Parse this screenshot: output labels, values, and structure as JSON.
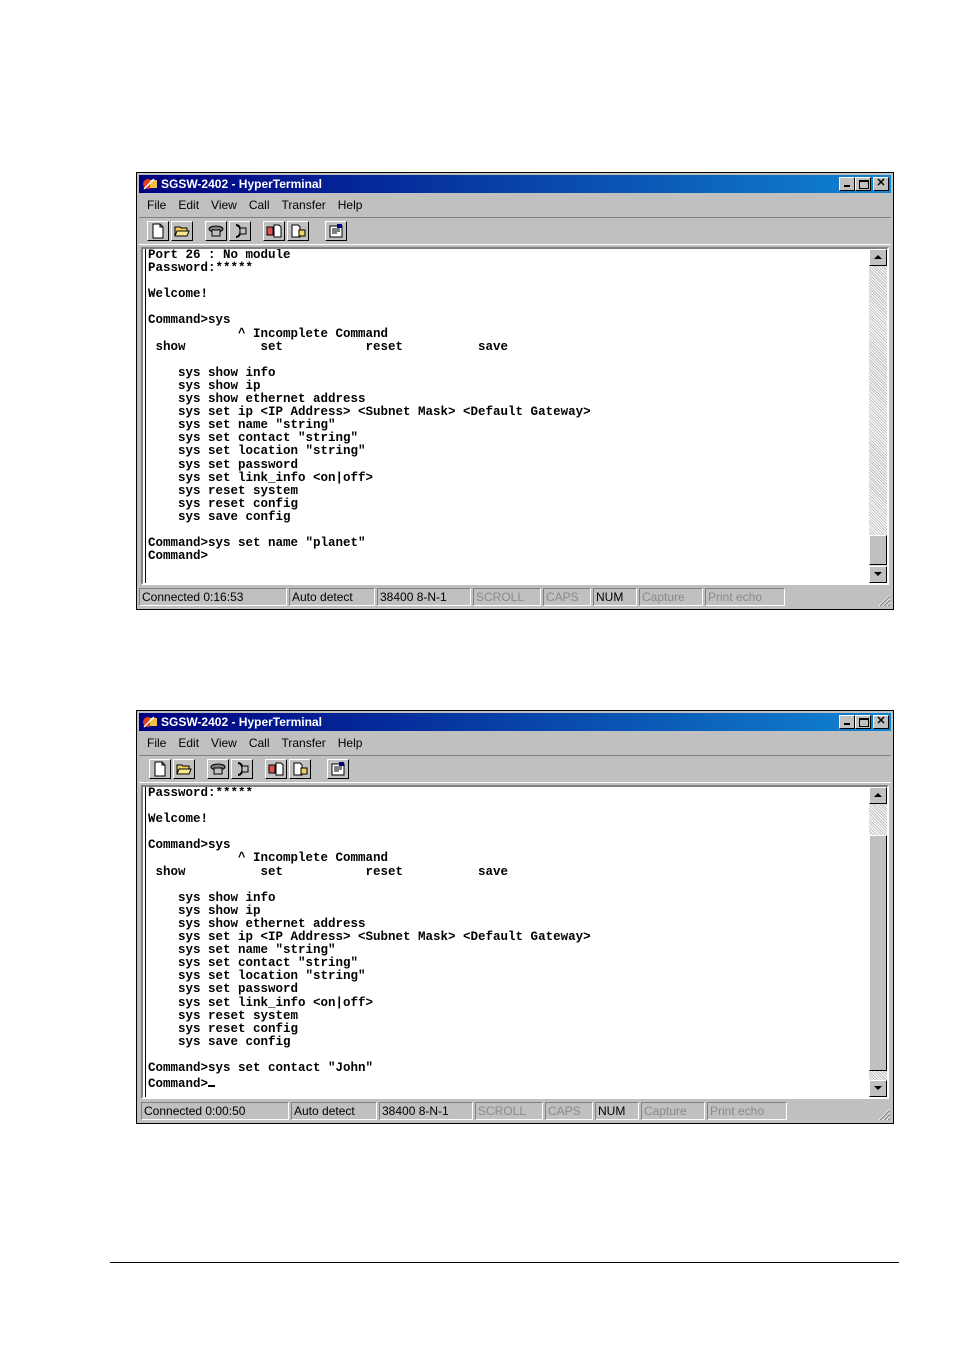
{
  "windows": [
    {
      "title": "SGSW-2402 - HyperTerminal",
      "menu": [
        "File",
        "Edit",
        "View",
        "Call",
        "Transfer",
        "Help"
      ],
      "terminal_lines": [
        "Port 26 : No module",
        "Password:*****",
        "",
        "Welcome!",
        "",
        "Command>sys",
        "            ^ Incomplete Command",
        " show          set           reset          save",
        "",
        "    sys show info",
        "    sys show ip",
        "    sys show ethernet address",
        "    sys set ip <IP Address> <Subnet Mask> <Default Gateway>",
        "    sys set name \"string\"",
        "    sys set contact \"string\"",
        "    sys set location \"string\"",
        "    sys set password",
        "    sys set link_info <on|off>",
        "    sys reset system",
        "    sys reset config",
        "    sys save config",
        "",
        "Command>sys set name \"planet\"",
        "Command>"
      ],
      "status": [
        "Connected 0:16:53",
        "Auto detect",
        "38400 8-N-1",
        "SCROLL",
        "CAPS",
        "NUM",
        "Capture",
        "Print echo"
      ]
    },
    {
      "title": "SGSW-2402 - HyperTerminal",
      "menu": [
        "File",
        "Edit",
        "View",
        "Call",
        "Transfer",
        "Help"
      ],
      "terminal_lines": [
        "Password:*****",
        "",
        "Welcome!",
        "",
        "Command>sys",
        "            ^ Incomplete Command",
        " show          set           reset          save",
        "",
        "    sys show info",
        "    sys show ip",
        "    sys show ethernet address",
        "    sys set ip <IP Address> <Subnet Mask> <Default Gateway>",
        "    sys set name \"string\"",
        "    sys set contact \"string\"",
        "    sys set location \"string\"",
        "    sys set password",
        "    sys set link_info <on|off>",
        "    sys reset system",
        "    sys reset config",
        "    sys save config",
        "",
        "Command>sys set contact \"John\"",
        "Command>"
      ],
      "status": [
        "Connected 0:00:50",
        "Auto detect",
        "38400 8-N-1",
        "SCROLL",
        "CAPS",
        "NUM",
        "Capture",
        "Print echo"
      ]
    }
  ],
  "toolbar_icons": [
    "new-document-icon",
    "open-folder-icon",
    "connect-phone-icon",
    "disconnect-phone-icon",
    "send-file-icon",
    "receive-file-icon",
    "properties-icon"
  ],
  "colors": {
    "titlebar_start": "#000080",
    "titlebar_end": "#1084d0",
    "window_face": "#c0c0c0",
    "terminal_bg": "#ffffff"
  }
}
